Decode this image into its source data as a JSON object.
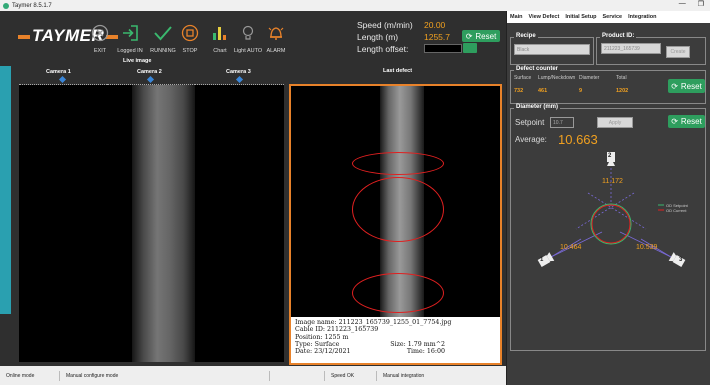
{
  "window": {
    "title": "Taymer 8.5.1.7",
    "minimize": "—",
    "maximize": "❐"
  },
  "toolbar": {
    "logo": "TAYMER",
    "exit_label": "EXIT",
    "login_label": "Logged IN",
    "running_label": "RUNNING",
    "stop_label": "STOP",
    "chart_label": "Chart",
    "light_label": "Light AUTO",
    "alarm_label": "ALARM"
  },
  "readouts": {
    "speed_label": "Speed (m/min)",
    "speed_value": "20.00",
    "length_label": "Length (m)",
    "length_value": "1255.7",
    "offset_label": "Length offset:",
    "reset_label": "Reset"
  },
  "live": {
    "caption": "Live image",
    "cameras": [
      "Camera 1",
      "Camera 2",
      "Camera 3"
    ],
    "slider_levels": [
      0.5,
      0.5,
      0.5
    ]
  },
  "defect": {
    "caption": "Last defect",
    "image_name": "Image name: 211223_165739_1255_01_7754.jpg",
    "cable_id": "Cable ID: 211223_165739",
    "position": "Position: 1255 m",
    "type": "Type: Surface",
    "size": "Size: 1.79 mm^2",
    "date": "Date: 23/12/2021",
    "time": "Time: 16:00"
  },
  "status": {
    "mode": "Online mode",
    "configure": "Manual configure mode",
    "blank": "",
    "speed_ok": "Speed OK",
    "integration": "Manual integration"
  },
  "tabs": [
    "Main",
    "View Defect",
    "Initial Setup",
    "Service",
    "Integration"
  ],
  "recipe": {
    "title": "Recipe",
    "value": "Black"
  },
  "product": {
    "title": "Product ID:",
    "value": "211223_165739",
    "create_label": "Create"
  },
  "counter": {
    "title": "Defect counter",
    "headers": [
      "Surface",
      "Lump/Neckdown",
      "Diameter",
      "Total"
    ],
    "values": [
      "732",
      "461",
      "9",
      "1202"
    ],
    "reset_label": "Reset"
  },
  "diameter": {
    "title": "Diameter (mm)",
    "setpoint_label": "Setpoint",
    "setpoint_value": "10.7",
    "apply_label": "Apply",
    "reset_label": "Reset",
    "average_label": "Average:",
    "average_value": "10.663",
    "cam_top": "2",
    "cam_left": "1",
    "cam_right": "3",
    "reading_top": "11.172",
    "reading_left": "10.464",
    "reading_right": "10.539",
    "legend_setpoint": "OD Setpoint",
    "legend_current": "OD Current"
  },
  "colors": {
    "accent": "#e8822a",
    "green": "#2e9e5e",
    "orange_value": "#f0a020",
    "teal": "#2aa0b0",
    "defect_mark": "#e02020"
  }
}
